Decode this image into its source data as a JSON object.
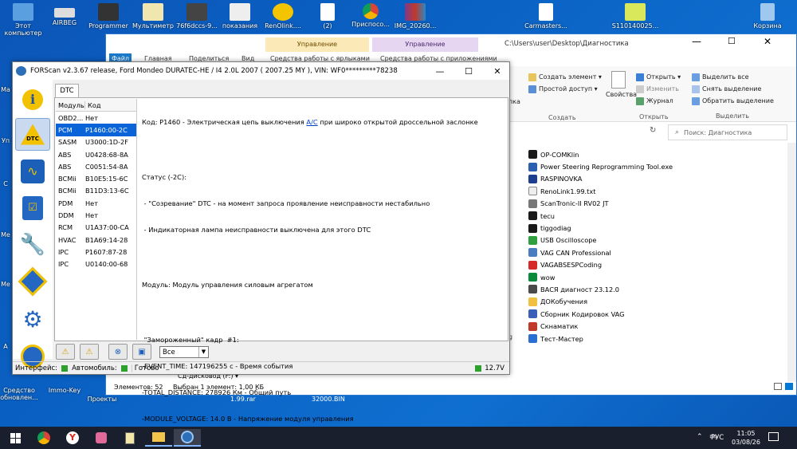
{
  "desktop": {
    "top_icons": [
      "Этот компьютер",
      "AIRBEG",
      "Programmer",
      "Мультиметр",
      "76f6dccs-9...",
      "показания",
      "RenOlink....",
      "(2)",
      "Приспосо...",
      "IMG_20260...",
      "Carmasters...",
      "S110140025...",
      "Корзина"
    ],
    "bottom_icons": [
      "Средство обновлен...",
      "Immo-Key",
      "Проекты"
    ],
    "side_fragments": [
      "Ма",
      "Уп",
      "С",
      "Ме",
      "Ме",
      "А"
    ]
  },
  "explorer": {
    "path": "C:\\Users\\user\\Desktop\\Диагностика",
    "ctx_tab1": "Управление",
    "ctx_tab2": "Управление",
    "tabs": [
      "Файл",
      "Главная",
      "Поделиться",
      "Вид",
      "Средства работы с ярлыками",
      "Средства работы с приложениями"
    ],
    "ribbon": {
      "new_item": "Создать элемент ▾",
      "easy_access": "Простой доступ ▾",
      "group_create": "Создать",
      "properties": "Свойства",
      "open": "Открыть ▾",
      "edit": "Изменить",
      "history": "Журнал",
      "group_open": "Открыть",
      "select_all": "Выделить все",
      "select_none": "Снять выделение",
      "invert": "Обратить выделение",
      "group_select": "Выделить",
      "paste_frag": "апка"
    },
    "search_placeholder": "Поиск: Диагностика",
    "files": [
      "OP-COMKlin",
      "Power Steering Reprogramming Tool.exe",
      "RASPINOVKA",
      "RenoLink1.99.txt",
      "ScanTronic-II RV02 JT",
      "tecu",
      "tiggodiag",
      "USB Oscilloscope",
      "VAG CAN Professional",
      "VAGABSESPCoding",
      "wow",
      "ВАСЯ диагност 23.12.0",
      "ДОКобучения",
      "Сборник Кодировок VAG",
      "Скнаматик",
      "Тест-Мастер"
    ],
    "status_count": "Элементов: 52",
    "status_selected": "Выбран 1 элемент: 1,00 КБ",
    "left_frag": "Сд-дисковод (F:) ▾",
    "bottom_labels": [
      "1.99.rar",
      "32000.BIN"
    ],
    "left_frag2": "eg"
  },
  "forscan": {
    "title": "FORScan v2.3.67 release, Ford Mondeo DURATEC-HE / I4 2.0L 2007 ( 2007.25 MY ), VIN: WF0*********78238",
    "tab": "DTC",
    "col_module": "Модуль",
    "col_code": "Код",
    "rows": [
      {
        "m": "OBD2...",
        "c": "Нет"
      },
      {
        "m": "PCM",
        "c": "P1460:00-2C"
      },
      {
        "m": "SASM",
        "c": "U3000:1D-2F"
      },
      {
        "m": "ABS",
        "c": "U0428:68-8A"
      },
      {
        "m": "ABS",
        "c": "C0051:54-8A"
      },
      {
        "m": "BCMii",
        "c": "B10E5:15-6C"
      },
      {
        "m": "BCMii",
        "c": "B11D3:13-6C"
      },
      {
        "m": "PDM",
        "c": "Нет"
      },
      {
        "m": "DDM",
        "c": "Нет"
      },
      {
        "m": "RCM",
        "c": "U1A37:00-CA"
      },
      {
        "m": "HVAC",
        "c": "B1A69:14-28"
      },
      {
        "m": "IPC",
        "c": "P1607:87-28"
      },
      {
        "m": "IPC",
        "c": "U0140:00-68"
      }
    ],
    "detail": {
      "code_prefix": "Код: P1460 - Электрическая цепь выключения ",
      "code_link": "A/C",
      "code_suffix": " при широко открытой дроссельной заслонке",
      "status_header": "Статус (-2C):",
      "status1": " - \"Созревание\" DTC - на момент запроса проявление неисправности нестабильно",
      "status2": " - Индикаторная лампа неисправности выключена для этого DTC",
      "module": "Модуль: Модуль управления силовым агрегатом",
      "frame": " \"Замороженный\" кадр  #1:",
      "event": "-EVENT_TIME: 147196255 c - Время события",
      "distance": "-TOTAL_DISTANCE: 278926 Км - Общий путь",
      "voltage": "-MODULE_VOLTAGE: 14.0 В - Напряжение модуля управления"
    },
    "filter": "Все",
    "status_interface": "Интерфейс:",
    "status_car": "Автомобиль:",
    "status_ok": "Готово",
    "voltage": "12.7V"
  },
  "taskbar": {
    "lang": "РУС",
    "time": "11:05",
    "date": "03/08/26"
  },
  "colors": {
    "accent": "#0078d7",
    "selected": "#0a64d8",
    "yellow": "#f2c200"
  }
}
